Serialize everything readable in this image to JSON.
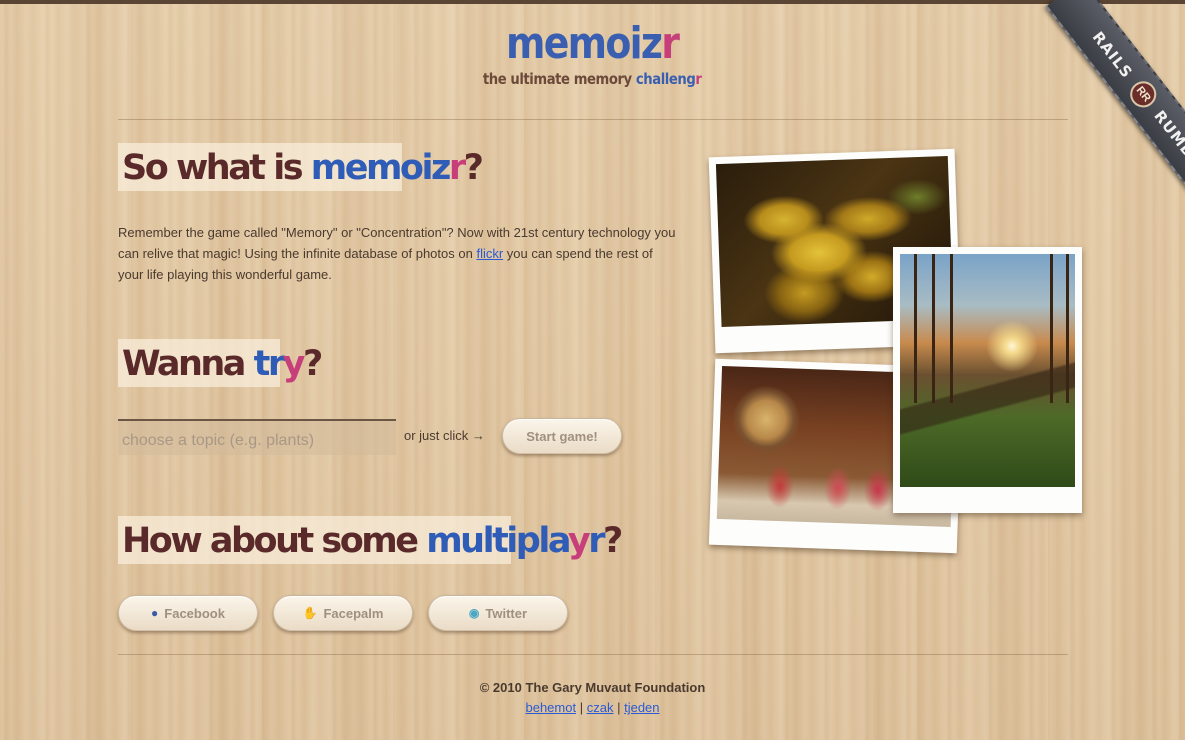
{
  "header": {
    "logo_main": "memoiz",
    "logo_accent": "r",
    "tagline_start": "the ultimate memory ",
    "tagline_blue": "challeng",
    "tagline_pink": "r"
  },
  "ribbon": {
    "left": "RAILS",
    "badge": "RR",
    "right": "RUMBLE"
  },
  "what": {
    "heading_start": "So what is ",
    "heading_blue": "memoiz",
    "heading_pink": "r",
    "heading_end": "?",
    "intro_before": "Remember the game called \"Memory\" or \"Concentration\"? Now with 21st century technology you can relive that magic! Using the infinite database of photos on ",
    "intro_link": "flickr",
    "intro_after": " you can spend the rest of your life playing this wonderful game."
  },
  "try": {
    "heading_start": "Wanna ",
    "heading_blue": "tr",
    "heading_pink": "y",
    "heading_end": "?",
    "input_placeholder": "choose a topic (e.g. plants)",
    "or_click": "or just click →",
    "start_label": "Start game!"
  },
  "multi": {
    "heading_start": "How about some ",
    "heading_blue": "multipla",
    "heading_pink": "y",
    "heading_blue2": "r",
    "heading_end": "?",
    "buttons": [
      {
        "label": "Facebook",
        "icon": "facebook-icon"
      },
      {
        "label": "Facepalm",
        "icon": "hand-icon"
      },
      {
        "label": "Twitter",
        "icon": "twitter-icon"
      }
    ]
  },
  "colors": {
    "brand_blue": "#3a5fb0",
    "brand_pink": "#c63f7a",
    "heading_brown": "#5a2a2a",
    "link_blue": "#2a5bd6"
  },
  "footer": {
    "copyright": "© 2010 The Gary Muvaut Foundation",
    "credits": [
      "behemot",
      "czak",
      "tjeden"
    ],
    "separator": "|"
  }
}
